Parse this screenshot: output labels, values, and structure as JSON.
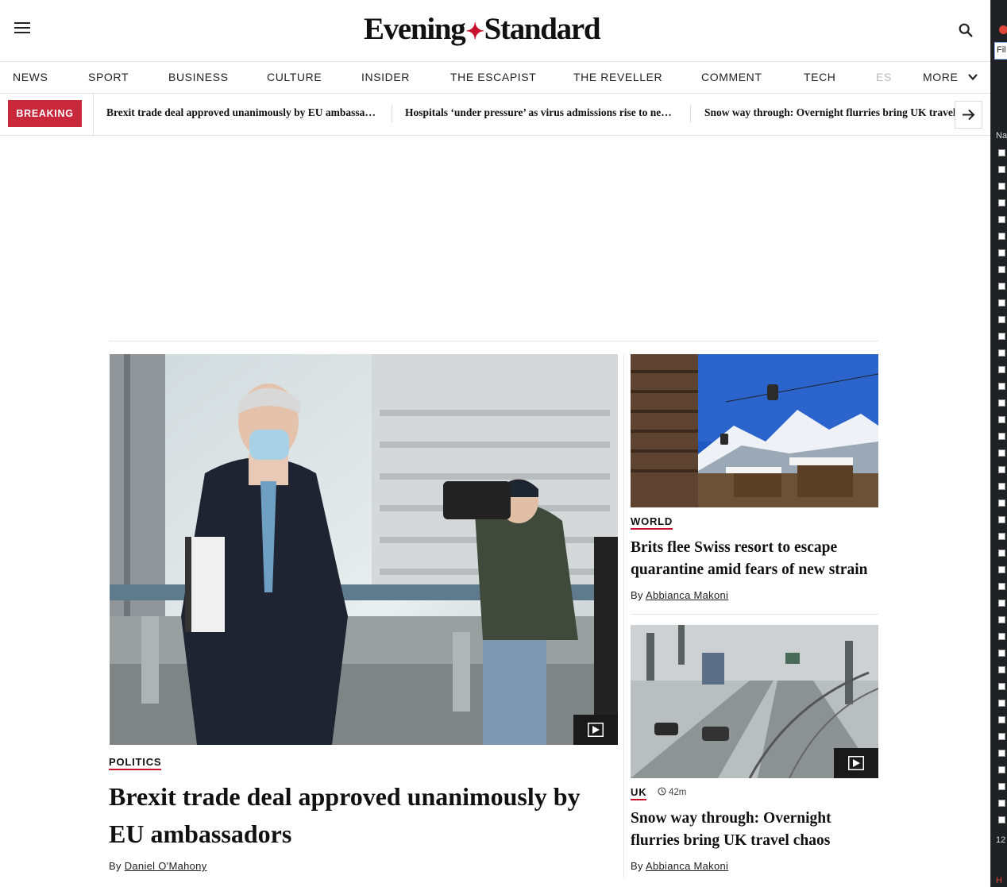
{
  "header": {
    "logo_left": "Evening",
    "logo_right": "Standard"
  },
  "nav": {
    "items": [
      "NEWS",
      "SPORT",
      "BUSINESS",
      "CULTURE",
      "INSIDER",
      "THE ESCAPIST",
      "THE REVELLER",
      "COMMENT",
      "TECH",
      "ES"
    ],
    "more_label": "MORE"
  },
  "breaking": {
    "label": "BREAKING",
    "items": [
      "Brexit trade deal approved unanimously by EU ambassadors",
      "Hospitals ‘under pressure’ as virus admissions rise to new high",
      "Snow way through: Overnight flurries bring UK travel chaos"
    ]
  },
  "lead": {
    "section": "POLITICS",
    "headline": "Brexit trade deal approved unanimously by EU ambassadors",
    "by": "By",
    "author": "Daniel O'Mahony"
  },
  "side_stories": [
    {
      "section": "WORLD",
      "headline": "Brits flee Swiss resort to escape quarantine amid fears of new strain",
      "by": "By",
      "author": "Abbianca Makoni"
    },
    {
      "section": "UK",
      "time": "42m",
      "headline": "Snow way through: Overnight flurries bring UK travel chaos",
      "by": "By",
      "author": "Abbianca Makoni"
    }
  ],
  "devtools": {
    "filter_text": "Fil",
    "name_col": "Na",
    "count_text": "12",
    "bottom_text": "H"
  },
  "colors": {
    "brand_red": "#c8102e",
    "breaking_bg": "#c8283a"
  }
}
